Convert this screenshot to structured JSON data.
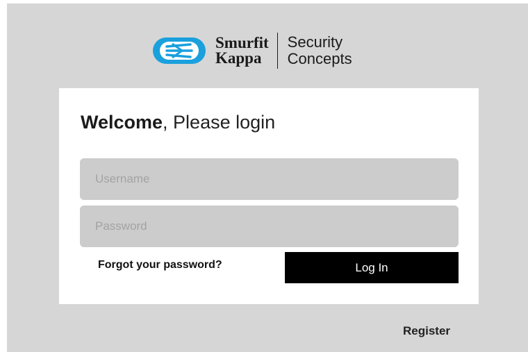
{
  "brand": {
    "company_line1": "Smurfit",
    "company_line2": "Kappa",
    "product_line1": "Security",
    "product_line2": "Concepts",
    "logo_icon": "smurfit-kappa-logo-icon",
    "logo_color": "#1aa0dd"
  },
  "login": {
    "heading_bold": "Welcome",
    "heading_rest": ", Please login",
    "username_placeholder": "Username",
    "username_value": "",
    "password_placeholder": "Password",
    "password_value": "",
    "forgot_label": "Forgot your password?",
    "login_label": "Log In"
  },
  "footer": {
    "register_label": "Register"
  },
  "colors": {
    "background": "#d6d6d6",
    "card": "#ffffff",
    "input": "#cccccc",
    "button": "#000000"
  }
}
